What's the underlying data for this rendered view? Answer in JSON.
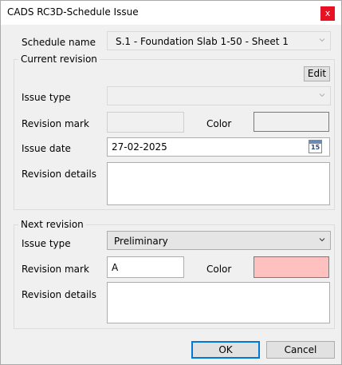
{
  "window": {
    "title": "CADS RC3D-Schedule Issue",
    "close_glyph": "x"
  },
  "schedule": {
    "label": "Schedule name",
    "value": "S.1 - Foundation Slab 1-50 - Sheet 1"
  },
  "current": {
    "group_label": "Current revision",
    "edit_label": "Edit",
    "issue_type_label": "Issue type",
    "issue_type_value": "",
    "revision_mark_label": "Revision mark",
    "revision_mark_value": "",
    "color_label": "Color",
    "color_value": "#f0f0f0",
    "issue_date_label": "Issue date",
    "issue_date_value": "27-02-2025",
    "calendar_day": "15",
    "revision_details_label": "Revision details",
    "revision_details_value": ""
  },
  "next": {
    "group_label": "Next revision",
    "issue_type_label": "Issue type",
    "issue_type_value": "Preliminary",
    "revision_mark_label": "Revision mark",
    "revision_mark_value": "A",
    "color_label": "Color",
    "color_value": "#ffc0c0",
    "revision_details_label": "Revision details",
    "revision_details_value": ""
  },
  "buttons": {
    "ok": "OK",
    "cancel": "Cancel"
  },
  "colors": {
    "accent": "#0078d7",
    "close": "#e81123",
    "next_swatch": "#ffc0c0"
  }
}
